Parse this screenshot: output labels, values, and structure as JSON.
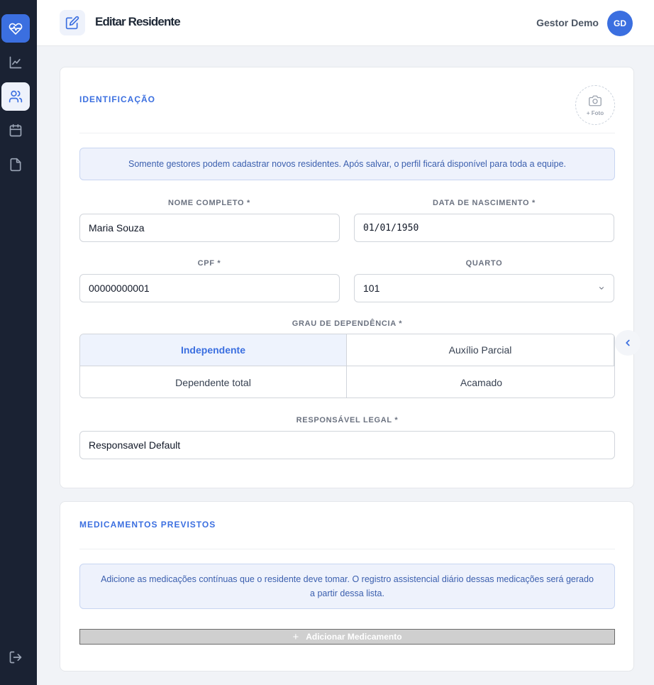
{
  "header": {
    "title": "Editar Residente",
    "user_name": "Gestor Demo",
    "avatar_initials": "GD"
  },
  "sidebar": {
    "items": [
      {
        "name": "brand-heart",
        "icon": "heart-pulse-icon"
      },
      {
        "name": "dashboard",
        "icon": "chart-line-icon"
      },
      {
        "name": "residents",
        "icon": "users-icon",
        "active": true
      },
      {
        "name": "calendar",
        "icon": "calendar-icon"
      },
      {
        "name": "documents",
        "icon": "file-icon"
      },
      {
        "name": "logout",
        "icon": "logout-icon"
      }
    ]
  },
  "identification": {
    "section_title": "IDENTIFICAÇÃO",
    "photo_label": "+ Foto",
    "notice": "Somente gestores podem cadastrar novos residentes. Após salvar, o perfil ficará disponível para toda a equipe.",
    "full_name": {
      "label": "NOME COMPLETO *",
      "value": "Maria Souza"
    },
    "birth_date": {
      "label": "DATA DE NASCIMENTO *",
      "value": "01/01/1950"
    },
    "cpf": {
      "label": "CPF *",
      "value": "00000000001"
    },
    "room": {
      "label": "QUARTO",
      "value": "101"
    },
    "dependency": {
      "label": "GRAU DE DEPENDÊNCIA *",
      "options": [
        "Independente",
        "Auxílio Parcial",
        "Dependente total",
        "Acamado"
      ],
      "selected": "Independente"
    },
    "guardian": {
      "label": "RESPONSÁVEL LEGAL *",
      "value": "Responsavel Default"
    }
  },
  "medications": {
    "section_title": "MEDICAMENTOS PREVISTOS",
    "notice": "Adicione as medicações contínuas que o residente deve tomar. O registro assistencial diário dessas medicações será gerado a partir dessa lista.",
    "add_button": "Adicionar Medicamento"
  },
  "colors": {
    "accent": "#3b6fe0",
    "sidebar": "#1a2233",
    "notice_bg": "#eef2fc"
  }
}
